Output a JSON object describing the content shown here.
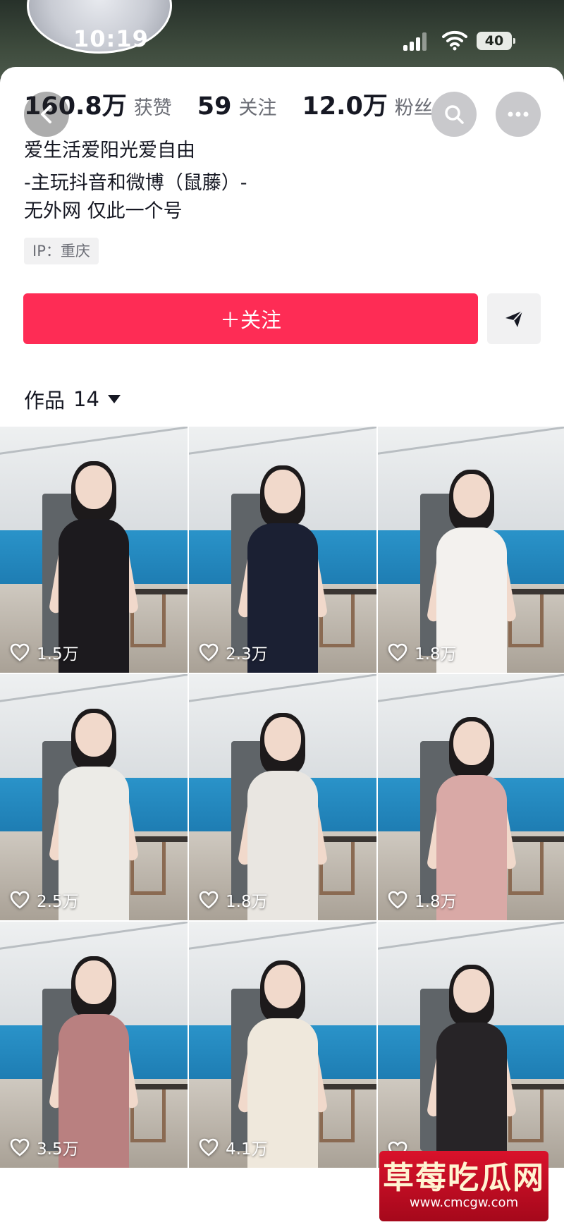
{
  "status_bar": {
    "time": "10:19",
    "battery": "40"
  },
  "stats": [
    {
      "value": "160.8万",
      "label": "获赞"
    },
    {
      "value": "59",
      "label": "关注"
    },
    {
      "value": "12.0万",
      "label": "粉丝"
    }
  ],
  "bio": [
    "爱生活爱阳光爱自由",
    "-主玩抖音和微博（鼠藤）-",
    "无外网 仅此一个号"
  ],
  "ip_label": "IP：重庆",
  "follow_label": "＋关注",
  "works": {
    "label": "作品",
    "count": "14"
  },
  "videos": [
    {
      "likes": "1.5万",
      "outfit_color": "#1c1a1e"
    },
    {
      "likes": "2.3万",
      "outfit_color": "#1b2033"
    },
    {
      "likes": "1.8万",
      "outfit_color": "#f3f1ee"
    },
    {
      "likes": "2.5万",
      "outfit_color": "#ecebe7"
    },
    {
      "likes": "1.8万",
      "outfit_color": "#e9e6e1"
    },
    {
      "likes": "1.8万",
      "outfit_color": "#d9a9a6"
    },
    {
      "likes": "3.5万",
      "outfit_color": "#b98080"
    },
    {
      "likes": "4.1万",
      "outfit_color": "#efe8dc"
    },
    {
      "likes": "",
      "outfit_color": "#272427"
    }
  ],
  "watermark": {
    "title": "草莓吃瓜网",
    "url": "www.cmcgw.com"
  },
  "colors": {
    "accent": "#fe2c55",
    "text": "#161823",
    "muted": "#6b6d75"
  }
}
